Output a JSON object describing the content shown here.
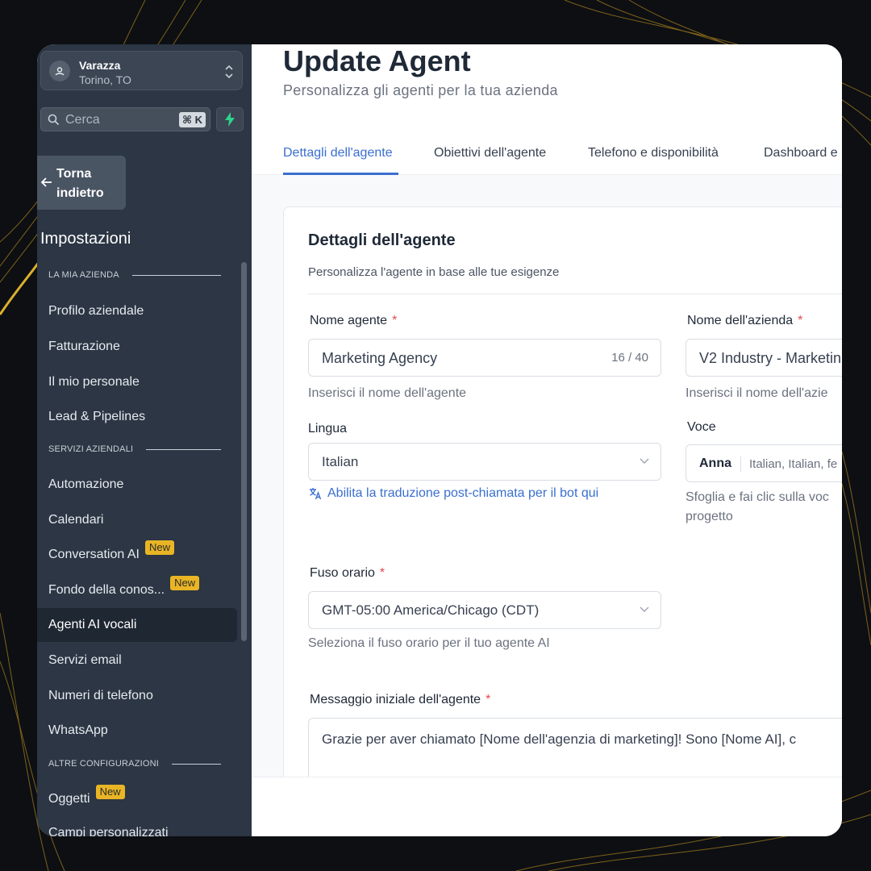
{
  "location": {
    "name": "Varazza",
    "city": "Torino, TO"
  },
  "search": {
    "placeholder": "Cerca",
    "shortcut": "⌘ K"
  },
  "back_button": {
    "label": "Torna indietro"
  },
  "sidebar": {
    "title": "Impostazioni",
    "sections": [
      {
        "heading": "LA MIA AZIENDA"
      },
      {
        "heading": "SERVIZI AZIENDALI"
      },
      {
        "heading": "ALTRE CONFIGURAZIONI"
      }
    ],
    "items": [
      {
        "label": "Profilo aziendale"
      },
      {
        "label": "Fatturazione"
      },
      {
        "label": "Il mio personale"
      },
      {
        "label": "Lead & Pipelines"
      },
      {
        "label": "Automazione"
      },
      {
        "label": "Calendari"
      },
      {
        "label": "Conversation AI",
        "badge": "New"
      },
      {
        "label": "Fondo della conos...",
        "badge": "New"
      },
      {
        "label": "Agenti AI vocali",
        "active": true
      },
      {
        "label": "Servizi email"
      },
      {
        "label": "Numeri di telefono"
      },
      {
        "label": "WhatsApp"
      },
      {
        "label": "Oggetti",
        "badge": "New"
      },
      {
        "label": "Campi personalizzati"
      }
    ]
  },
  "page": {
    "title": "Update Agent",
    "subtitle": "Personalizza gli agenti per la tua azienda"
  },
  "tabs": [
    {
      "label": "Dettagli dell'agente",
      "active": true
    },
    {
      "label": "Obiettivi dell'agente"
    },
    {
      "label": "Telefono e disponibilità"
    },
    {
      "label": "Dashboard e"
    }
  ],
  "card": {
    "title": "Dettagli dell'agente",
    "subtitle": "Personalizza l'agente in base alle tue esigenze",
    "required_mark": "*",
    "agent_name": {
      "label": "Nome agente",
      "value": "Marketing Agency",
      "counter": "16 / 40",
      "help": "Inserisci il nome dell'agente"
    },
    "company_name": {
      "label": "Nome dell'azienda",
      "value": "V2 Industry - Marketin",
      "help": "Inserisci il nome dell'azie"
    },
    "language": {
      "label": "Lingua",
      "value": "Italian",
      "translate_link": "Abilita la traduzione post-chiamata per il bot qui"
    },
    "voice": {
      "label": "Voce",
      "name": "Anna",
      "description": "Italian, Italian, fe",
      "help_line1": "Sfoglia e fai clic sulla voc",
      "help_line2": "progetto"
    },
    "timezone": {
      "label": "Fuso orario",
      "value": "GMT-05:00 America/Chicago (CDT)",
      "help": "Seleziona il fuso orario per il tuo agente AI"
    },
    "initial_message": {
      "label": "Messaggio iniziale dell'agente",
      "value": "Grazie per aver chiamato [Nome dell'agenzia di marketing]! Sono [Nome AI], c"
    }
  },
  "colors": {
    "accent": "#3a6fcf",
    "sidebar_bg": "#2c3644",
    "badge": "#e9b525",
    "required": "#e5484d",
    "gold_lines": "#d9a51f"
  }
}
